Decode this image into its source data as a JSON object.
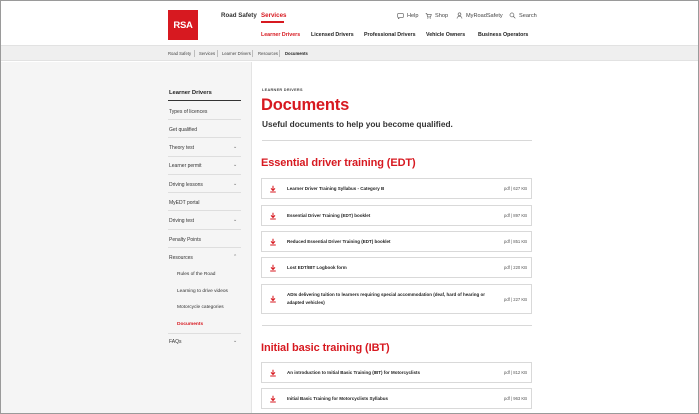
{
  "header": {
    "logo_text": "RSA",
    "nav": [
      {
        "label": "Road Safety",
        "active": false
      },
      {
        "label": "Services",
        "active": true
      }
    ],
    "utility": [
      {
        "label": "Help",
        "icon": "help-icon"
      },
      {
        "label": "Shop",
        "icon": "cart-icon"
      },
      {
        "label": "MyRoadSafety",
        "icon": "user-icon"
      },
      {
        "label": "Search",
        "icon": "search-icon"
      }
    ],
    "subnav": [
      "Learner Drivers",
      "Licensed Drivers",
      "Professional Drivers",
      "Vehicle Owners",
      "Business Operators"
    ]
  },
  "breadcrumb": [
    "Road Safety",
    "Services",
    "Learner Drivers",
    "Resources",
    "Documents"
  ],
  "sidebar": {
    "title": "Learner Drivers",
    "items": [
      {
        "label": "Types of licences",
        "expandable": false
      },
      {
        "label": "Get qualified",
        "expandable": false
      },
      {
        "label": "Theory test",
        "expandable": true
      },
      {
        "label": "Learner permit",
        "expandable": true
      },
      {
        "label": "Driving lessons",
        "expandable": true
      },
      {
        "label": "MyEDT portal",
        "expandable": false
      },
      {
        "label": "Driving test",
        "expandable": true
      },
      {
        "label": "Penalty Points",
        "expandable": false
      },
      {
        "label": "Resources",
        "expandable": true,
        "expanded": true
      },
      {
        "label": "FAQs",
        "expandable": true
      }
    ],
    "resources_sub": [
      {
        "label": "Rules of the Road",
        "active": false
      },
      {
        "label": "Learning to drive videos",
        "active": false
      },
      {
        "label": "Motorcycle categories",
        "active": false
      },
      {
        "label": "Documents",
        "active": true
      }
    ]
  },
  "main": {
    "eyebrow": "LEARNER DRIVERS",
    "title": "Documents",
    "lead": "Useful documents to help you become qualified.",
    "sections": [
      {
        "heading": "Essential driver training (EDT)",
        "docs": [
          {
            "name": "Learner Driver Training Syllabus - Category B",
            "meta": "pdf | 627 KB"
          },
          {
            "name": "Essential Driver Training (EDT) booklet",
            "meta": "pdf | 897 KB"
          },
          {
            "name": "Reduced Essential Driver Training (EDT) booklet",
            "meta": "pdf | 851 KB"
          },
          {
            "name": "Lost EDT/IBT Logbook form",
            "meta": "pdf | 220 KB"
          },
          {
            "name": "ADIs delivering tuition to learners requiring special accommodation (deaf, hard of hearing or adapted vehicles)",
            "meta": "pdf | 227 KB"
          }
        ]
      },
      {
        "heading": "Initial basic training (IBT)",
        "docs": [
          {
            "name": "An introduction to Initial Basic Training (IBT) for Motorcyclists",
            "meta": "pdf | 812 KB"
          },
          {
            "name": "Initial Basic Training for Motorcyclists Syllabus",
            "meta": "pdf | 963 KB"
          }
        ]
      }
    ]
  },
  "colors": {
    "brand_red": "#d71920",
    "sidebar_bg": "#f5f5f5",
    "breadcrumb_bg": "#efefef"
  }
}
